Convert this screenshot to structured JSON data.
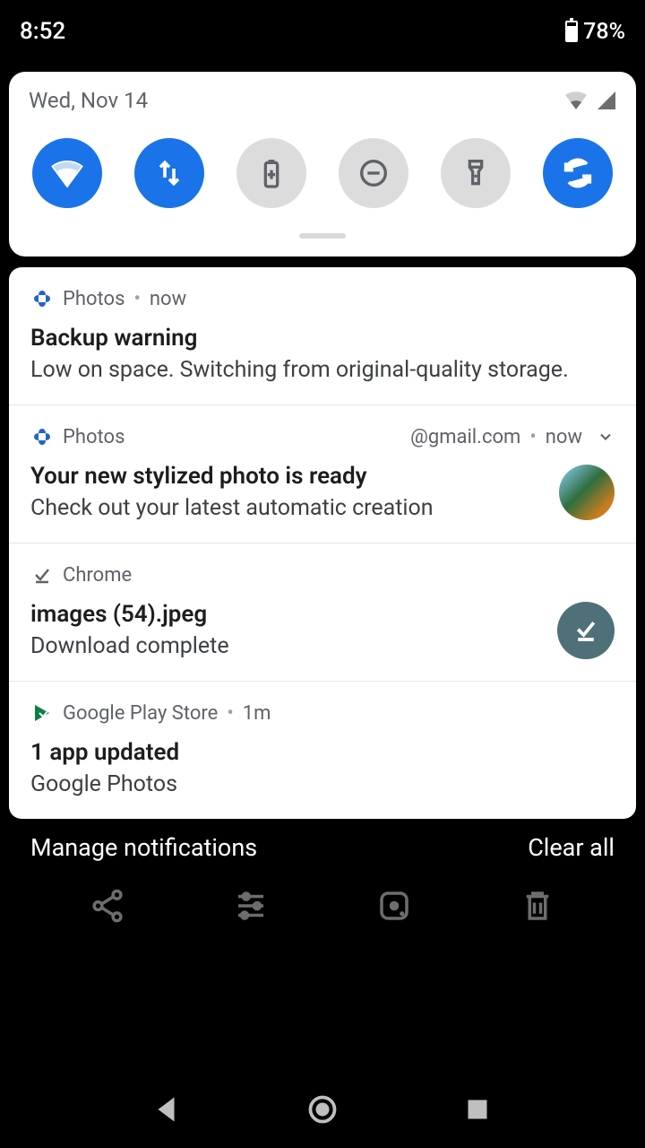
{
  "status": {
    "time": "8:52",
    "battery": "78%"
  },
  "qs": {
    "date": "Wed, Nov 14",
    "tiles": [
      {
        "name": "wifi",
        "active": true
      },
      {
        "name": "mobile-data",
        "active": true
      },
      {
        "name": "battery-saver",
        "active": false
      },
      {
        "name": "dnd",
        "active": false
      },
      {
        "name": "flashlight",
        "active": false
      },
      {
        "name": "auto-rotate",
        "active": true
      }
    ]
  },
  "notifications": [
    {
      "id": "photos-backup",
      "app": "Photos",
      "meta": "now",
      "title": "Backup warning",
      "body": "Low on space. Switching from original-quality storage."
    },
    {
      "id": "photos-stylized",
      "app": "Photos",
      "account": "@gmail.com",
      "meta": "now",
      "title": "Your new stylized photo is ready",
      "body": "Check out your latest automatic creation",
      "has_thumb": true,
      "expandable": true
    },
    {
      "id": "chrome-download",
      "app": "Chrome",
      "title": "images (54).jpeg",
      "body": "Download complete",
      "has_badge": true
    },
    {
      "id": "play-update",
      "app": "Google Play Store",
      "meta": "1m",
      "title": "1 app updated",
      "body": "Google Photos"
    }
  ],
  "footer": {
    "manage": "Manage notifications",
    "clear": "Clear all"
  }
}
